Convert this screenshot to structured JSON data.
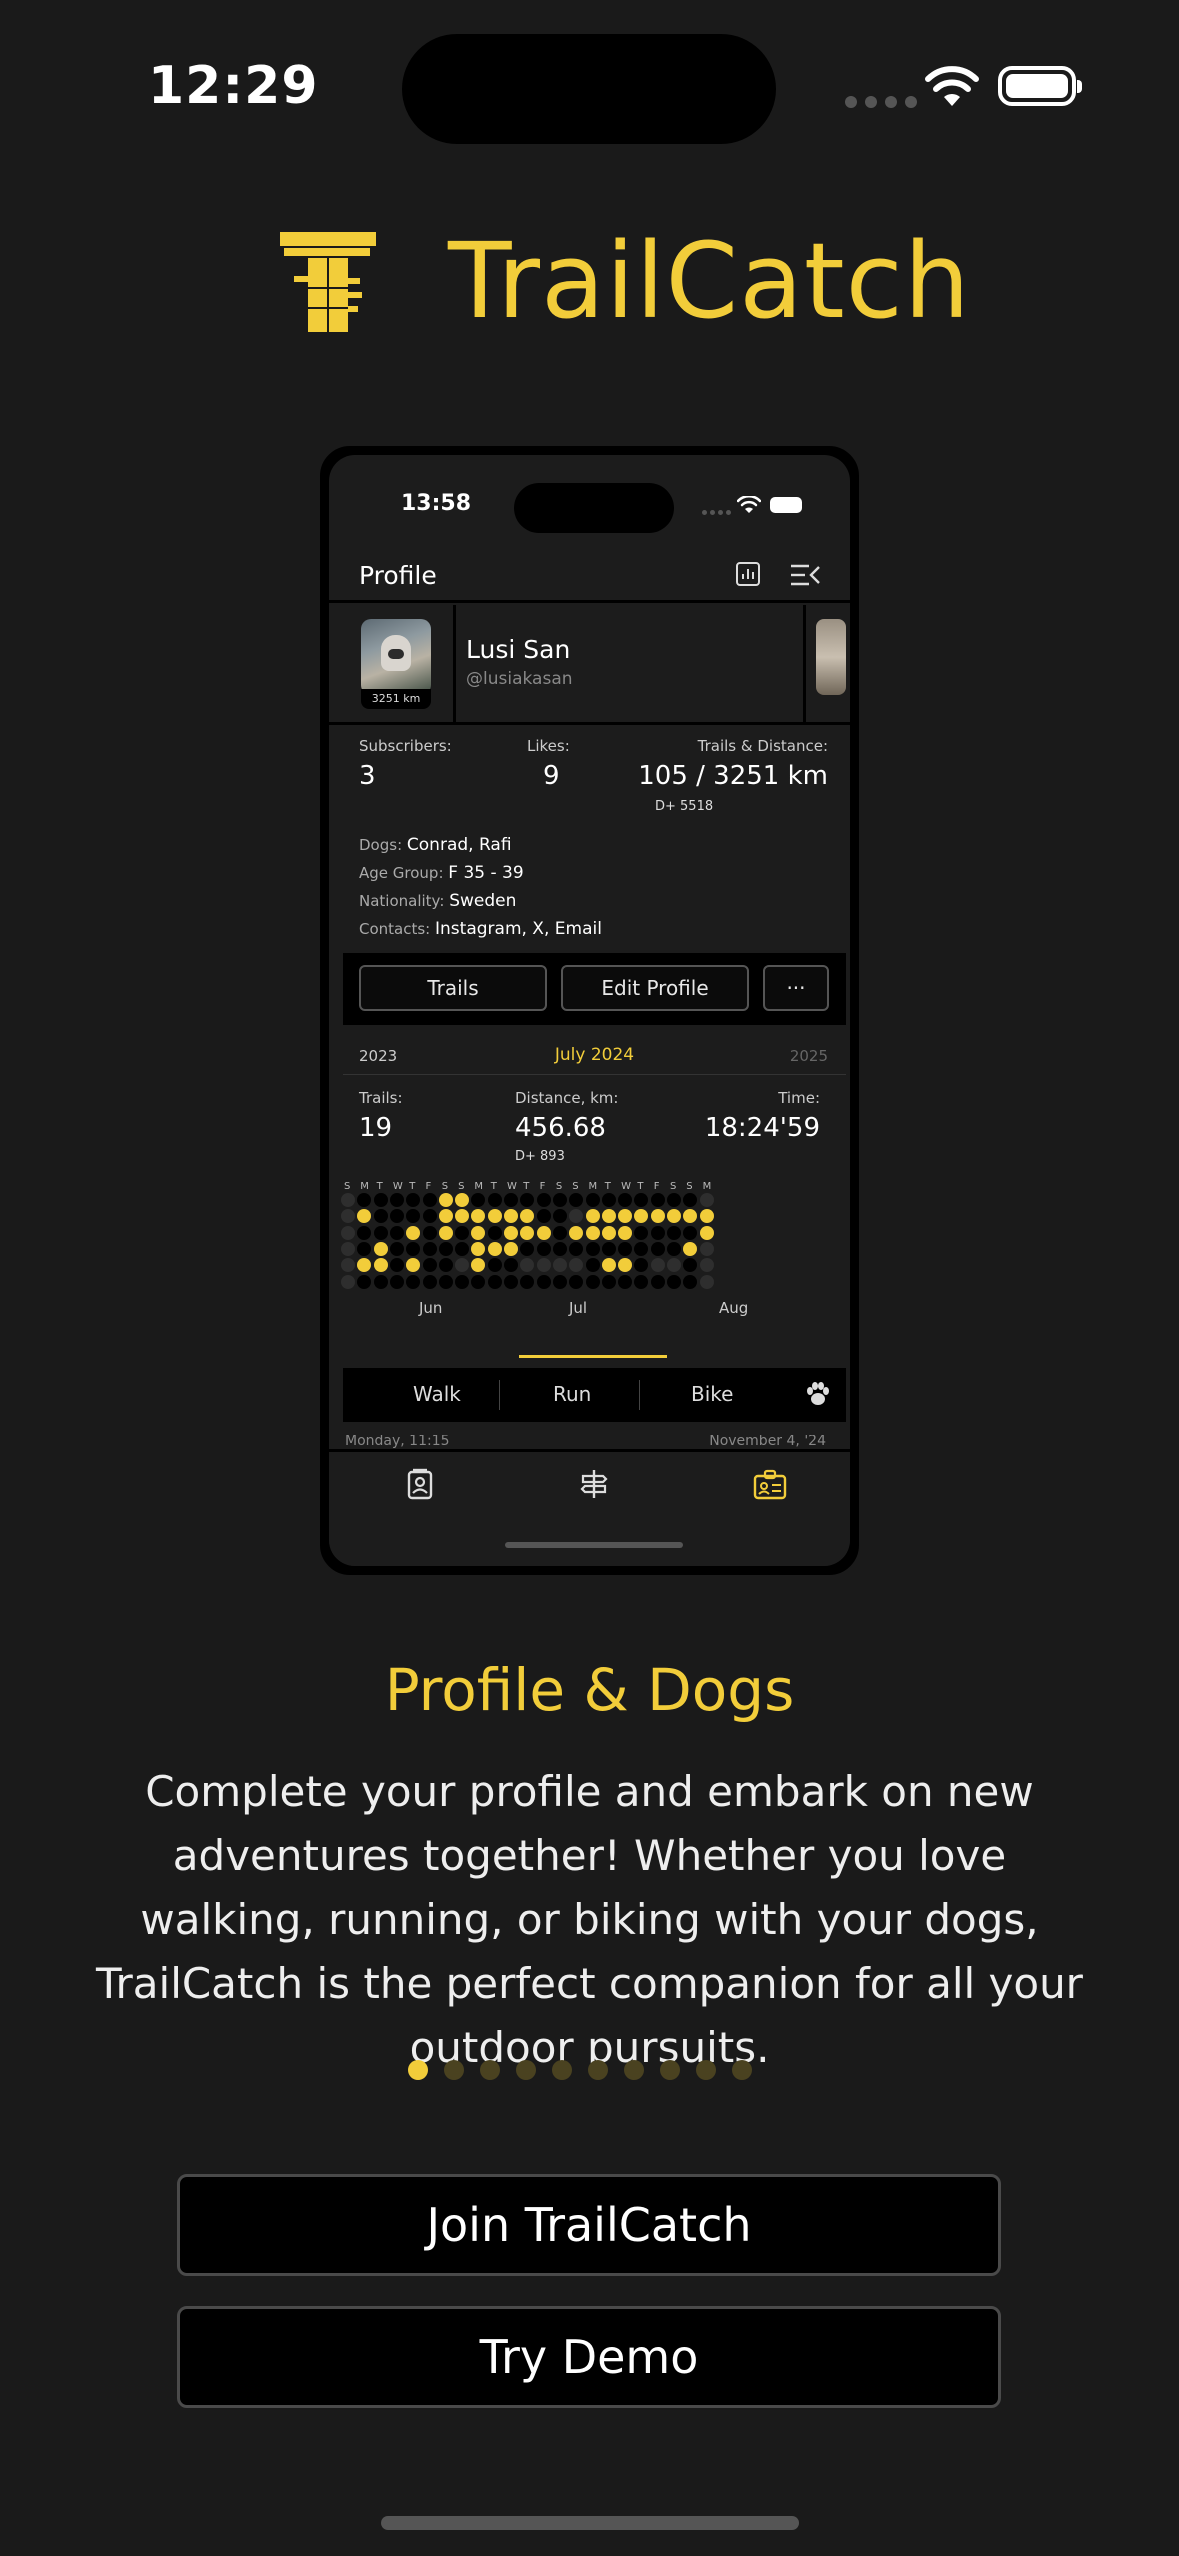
{
  "status": {
    "time": "12:29"
  },
  "brand": {
    "name": "TrailCatch",
    "accent": "#f2cd3a"
  },
  "phone": {
    "status_time": "13:58",
    "header": {
      "title": "Profile"
    },
    "profile": {
      "name": "Lusi San",
      "handle": "@lusiakasan",
      "avatar_km": "3251 km"
    },
    "stats": {
      "subscribers_label": "Subscribers:",
      "subscribers": "3",
      "likes_label": "Likes:",
      "likes": "9",
      "trails_label": "Trails & Distance:",
      "trails": "105 / 3251 km",
      "elevation": "D+ 5518"
    },
    "info": [
      {
        "label": "Dogs:",
        "value": "Conrad, Rafi"
      },
      {
        "label": "Age Group:",
        "value": "F 35 - 39"
      },
      {
        "label": "Nationality:",
        "value": "Sweden"
      },
      {
        "label": "Contacts:",
        "value": "Instagram, X, Email"
      }
    ],
    "actions": {
      "trails": "Trails",
      "edit": "Edit Profile",
      "more": "···"
    },
    "year_nav": {
      "prev": "2023",
      "current": "July 2024",
      "next": "2025"
    },
    "month_stats": {
      "trails_label": "Trails:",
      "trails": "19",
      "distance_label": "Distance, km:",
      "distance": "456.68",
      "elevation": "D+ 893",
      "time_label": "Time:",
      "time": "18:24'59"
    },
    "calendar": {
      "months": [
        "Jun",
        "Jul",
        "Aug"
      ],
      "weekday_headers": [
        "S",
        "M",
        "T",
        "W",
        "T",
        "F",
        "S",
        "S",
        "M",
        "T",
        "W",
        "T",
        "F",
        "S",
        "S",
        "M",
        "T",
        "W",
        "T",
        "F",
        "S",
        "S",
        "M"
      ]
    },
    "segments": [
      "Walk",
      "Run",
      "Bike"
    ],
    "list_peek": {
      "left": "Monday, 11:15",
      "right": "November 4, '24"
    }
  },
  "onboarding": {
    "title": "Profile & Dogs",
    "body": "Complete your profile and embark on new adventures together! Whether you love walking, running, or biking with your dogs, TrailCatch is the perfect companion for all your outdoor pursuits.",
    "page_index": 1,
    "page_count": 10
  },
  "buttons": {
    "join": "Join TrailCatch",
    "demo": "Try Demo"
  }
}
